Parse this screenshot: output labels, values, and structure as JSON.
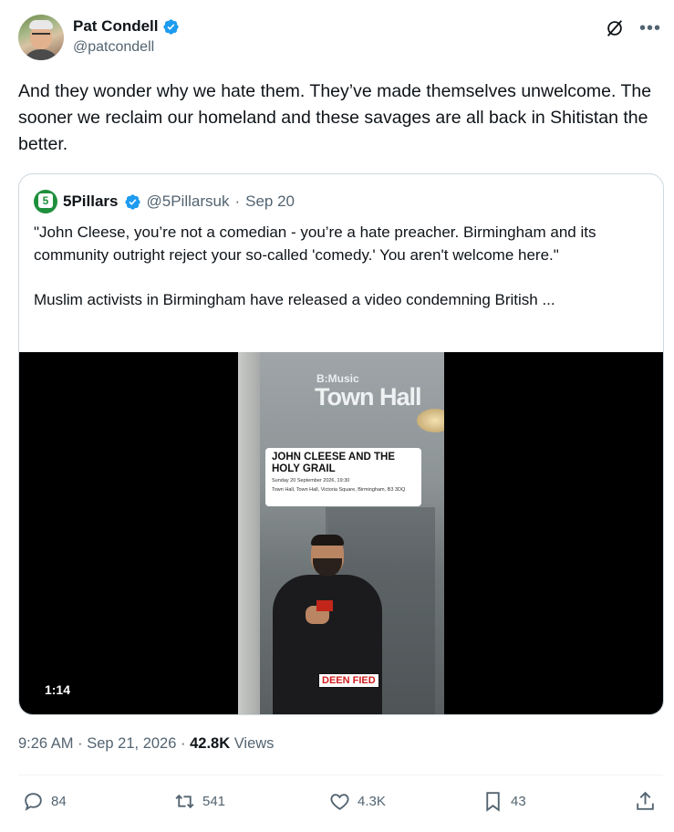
{
  "author": {
    "name": "Pat Condell",
    "handle": "@patcondell"
  },
  "tweet": {
    "text": "And they wonder why we hate them. They’ve made themselves unwelcome. The sooner we reclaim our homeland and these savages are all back in Shitistan the better."
  },
  "quoted": {
    "logo_text": "5",
    "name": "5Pillars",
    "handle": "@5Pillarsuk",
    "separator": "·",
    "date": "Sep 20",
    "text": "\"John Cleese, you’re not a comedian - you’re a hate preacher. Birmingham and its community outright reject your so-called 'comedy.' You aren't welcome here.\"\n\nMuslim activists in Birmingham have released a video condemning British ...",
    "video": {
      "venue_sub": "B:Music",
      "venue_title": "Town Hall",
      "event_title": "JOHN CLEESE AND THE HOLY GRAIL",
      "event_date": "Sunday 20 September 2026, 19:30",
      "event_address": "Town Hall, Town Hall, Victoria Square, Birmingham, B3 3DQ",
      "watermark": "DEEN FIED",
      "duration": "1:14"
    }
  },
  "meta": {
    "time": "9:26 AM",
    "sep1": "·",
    "date": "Sep 21, 2026",
    "sep2": "·",
    "views_count": "42.8K",
    "views_label": "Views"
  },
  "actions": {
    "replies": "84",
    "reposts": "541",
    "likes": "4.3K",
    "bookmarks": "43"
  },
  "colors": {
    "verified": "#1d9bf0",
    "secondary_text": "#536471",
    "border": "#cfd9de"
  }
}
